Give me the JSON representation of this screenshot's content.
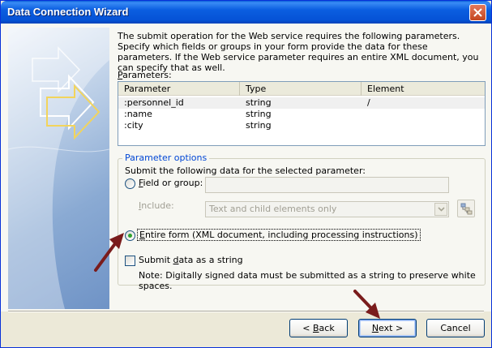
{
  "window": {
    "title": "Data Connection Wizard"
  },
  "intro_text": "The submit operation for the Web service requires the following parameters. Specify which fields or groups in your form provide the data for these parameters. If the Web service parameter requires an entire XML document, you can specify that as well.",
  "parameters": {
    "label_mnemonic": "P",
    "label_rest": "arameters:",
    "columns": [
      "Parameter",
      "Type",
      "Element"
    ],
    "rows": [
      {
        "parameter": ":personnel_id",
        "type": "string",
        "element": "/"
      },
      {
        "parameter": ":name",
        "type": "string",
        "element": ""
      },
      {
        "parameter": ":city",
        "type": "string",
        "element": ""
      }
    ]
  },
  "options": {
    "group_title": "Parameter options",
    "submit_label": "Submit the following data for the selected parameter:",
    "field_or_group_mnemonic": "F",
    "field_or_group_rest": "ield or group:",
    "field_value": "",
    "include_mnemonic": "I",
    "include_rest": "nclude:",
    "include_value": "Text and child elements only",
    "entire_form_mnemonic": "E",
    "entire_form_rest": "ntire form (XML document, including processing instructions)",
    "submit_string_prefix": "Submit ",
    "submit_string_mnemonic": "d",
    "submit_string_rest": "ata as a string",
    "note": "Note: Digitally signed data must be submitted as a string to preserve white spaces."
  },
  "buttons": {
    "back_prefix": "< ",
    "back_mnemonic": "B",
    "back_rest": "ack",
    "next_mnemonic": "N",
    "next_rest": "ext >",
    "cancel": "Cancel"
  },
  "icons": {
    "close": "close-icon",
    "select_tree": "select-field-icon"
  },
  "colors": {
    "title_bar": "#0553d6",
    "group_title": "#0046d5",
    "annotation_arrow": "#7a1c1c",
    "radio_dot": "#2fa32f"
  }
}
